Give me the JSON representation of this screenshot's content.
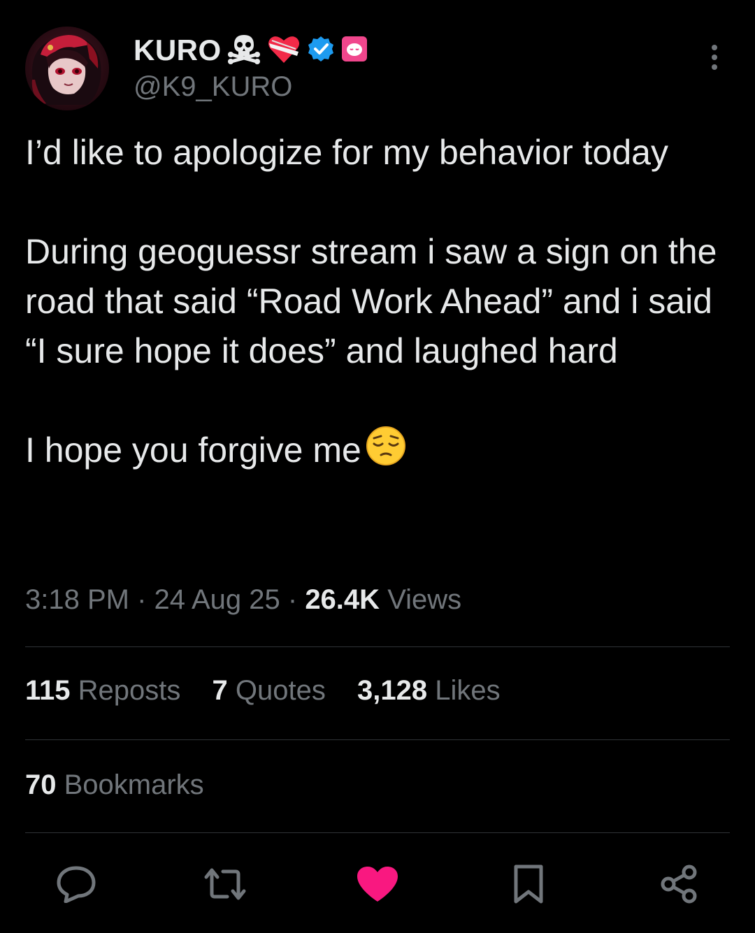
{
  "author": {
    "display_name": "KURO",
    "handle": "@K9_KURO",
    "badges": [
      "skull-crossbones-icon",
      "bandaged-heart-icon",
      "verified-badge-icon",
      "pink-face-icon"
    ]
  },
  "tweet": {
    "paragraphs": [
      "I’d like to apologize for my behavior today",
      "During geoguessr stream i saw a sign on the road that said “Road Work Ahead” and i said “I sure hope it does” and laughed hard",
      "I hope you forgive me"
    ],
    "trailing_emoji": "pensive-face-icon",
    "time": "3:18 PM",
    "date": "24 Aug 25",
    "views_count": "26.4K",
    "views_label": "Views",
    "separator": "·"
  },
  "stats": {
    "reposts_count": "115",
    "reposts_label": "Reposts",
    "quotes_count": "7",
    "quotes_label": "Quotes",
    "likes_count": "3,128",
    "likes_label": "Likes",
    "bookmarks_count": "70",
    "bookmarks_label": "Bookmarks"
  },
  "actions": [
    "reply-icon",
    "repost-icon",
    "like-icon",
    "bookmark-icon",
    "share-icon"
  ],
  "colors": {
    "background": "#000000",
    "text": "#e7e9ea",
    "muted": "#71767b",
    "divider": "#2f3336",
    "like_active": "#f91880",
    "verified": "#1d9bf0"
  }
}
